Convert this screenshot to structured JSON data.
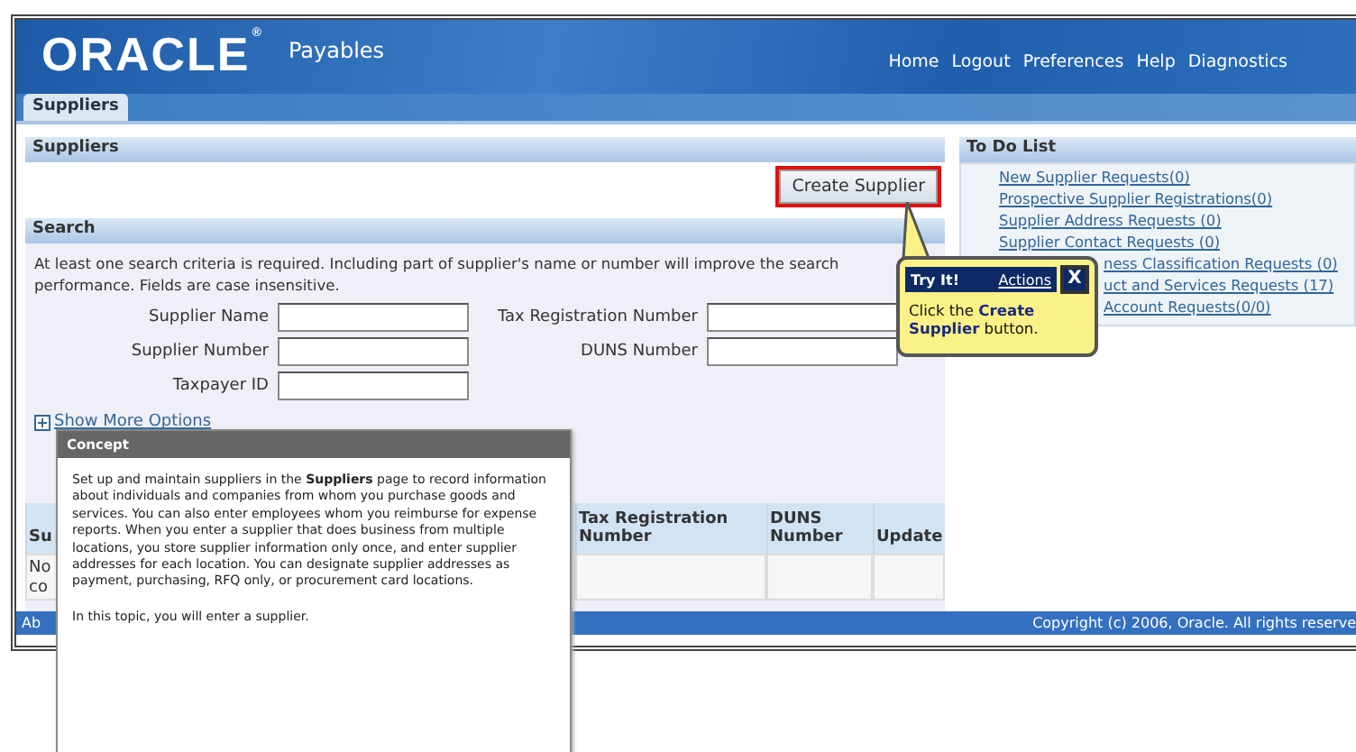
{
  "header": {
    "logo": "ORACLE",
    "logo_mark": "®",
    "product": "Payables",
    "links": [
      "Home",
      "Logout",
      "Preferences",
      "Help",
      "Diagnostics"
    ]
  },
  "tabs": [
    {
      "label": "Suppliers",
      "selected": true
    }
  ],
  "suppliers_section": {
    "title": "Suppliers",
    "button": "Create Supplier",
    "highlighted": true
  },
  "search": {
    "title": "Search",
    "instructions": "At least one search criteria is required. Including part of supplier's name or number will improve the search performance. Fields are case insensitive.",
    "fields_left": [
      {
        "label": "Supplier Name"
      },
      {
        "label": "Supplier Number"
      },
      {
        "label": "Taxpayer ID"
      }
    ],
    "fields_right": [
      {
        "label": "Tax Registration Number"
      },
      {
        "label": "DUNS Number"
      }
    ],
    "more_options": "Show More Options"
  },
  "results": {
    "columns": [
      "Su",
      "Tax Registration Number",
      "DUNS Number",
      "Update"
    ],
    "empty_text": [
      "No",
      "co"
    ]
  },
  "todo": {
    "title": "To Do List",
    "items": [
      {
        "label": "New Supplier Requests(0)",
        "kind": "full"
      },
      {
        "label": "Prospective Supplier Registrations(0)",
        "kind": "full"
      },
      {
        "label": "Supplier Address Requests (0)",
        "kind": "full"
      },
      {
        "label": "Supplier Contact Requests (0)",
        "kind": "full"
      },
      {
        "label": "ness Classification Requests (0)",
        "kind": "clipped"
      },
      {
        "label": "uct and Services Requests (17)",
        "kind": "clipped"
      },
      {
        "label": "Account Requests(0/0)",
        "kind": "clipped"
      }
    ]
  },
  "footer": {
    "left": "Ab",
    "copyright": "Copyright (c) 2006, Oracle. All rights reserve"
  },
  "tryit": {
    "title": "Try It!",
    "actions": "Actions",
    "close": "X",
    "text": "Click the **Create Supplier** button."
  },
  "concept": {
    "title": "Concept",
    "paragraphs": [
      "Set up and maintain suppliers in the **Suppliers** page to record information about individuals and companies from whom you purchase goods and services. You can also enter employees whom you reimburse for expense reports. When you enter a supplier that does business from multiple locations, you store supplier information only once, and enter supplier addresses for each location. You can designate supplier addresses as payment, purchasing, RFQ only, or procurement card locations.",
      "In this topic, you will enter a supplier."
    ]
  }
}
